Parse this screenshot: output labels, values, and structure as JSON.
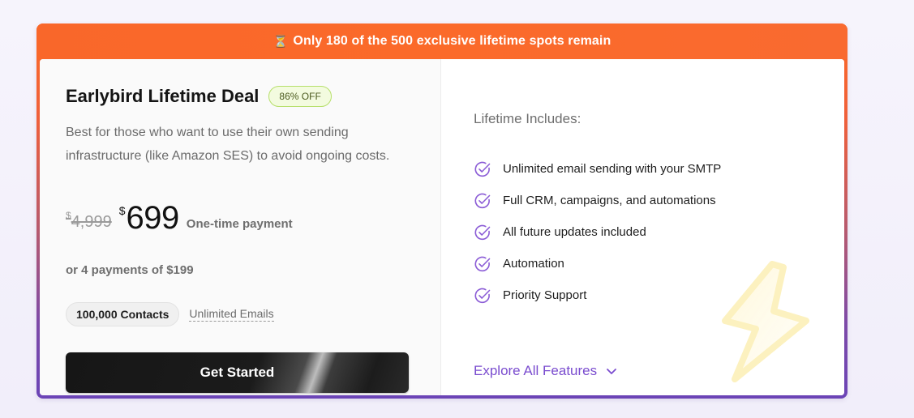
{
  "banner": {
    "icon": "hourglass-icon",
    "text": "Only 180 of the 500 exclusive lifetime spots remain"
  },
  "plan": {
    "title": "Earlybird Lifetime Deal",
    "badge": "86% OFF",
    "description": "Best for those who want to use their own sending infrastructure (like Amazon SES) to avoid ongoing costs.",
    "currency": "$",
    "old_price": "4,999",
    "new_price": "699",
    "payment_type": "One-time payment",
    "installments": "or 4 payments of $199",
    "chips": {
      "contacts": "100,000 Contacts",
      "emails": "Unlimited Emails"
    },
    "cta_label": "Get Started"
  },
  "includes": {
    "title": "Lifetime Includes:",
    "items": [
      "Unlimited email sending with your SMTP",
      "Full CRM, campaigns, and automations",
      "All future updates included",
      "Automation",
      "Priority Support"
    ],
    "explore_label": "Explore All Features"
  },
  "colors": {
    "banner": "#fb6a2a",
    "accent_purple": "#7a4ccf",
    "badge_border": "#b6df6a",
    "cta": "#161616"
  }
}
